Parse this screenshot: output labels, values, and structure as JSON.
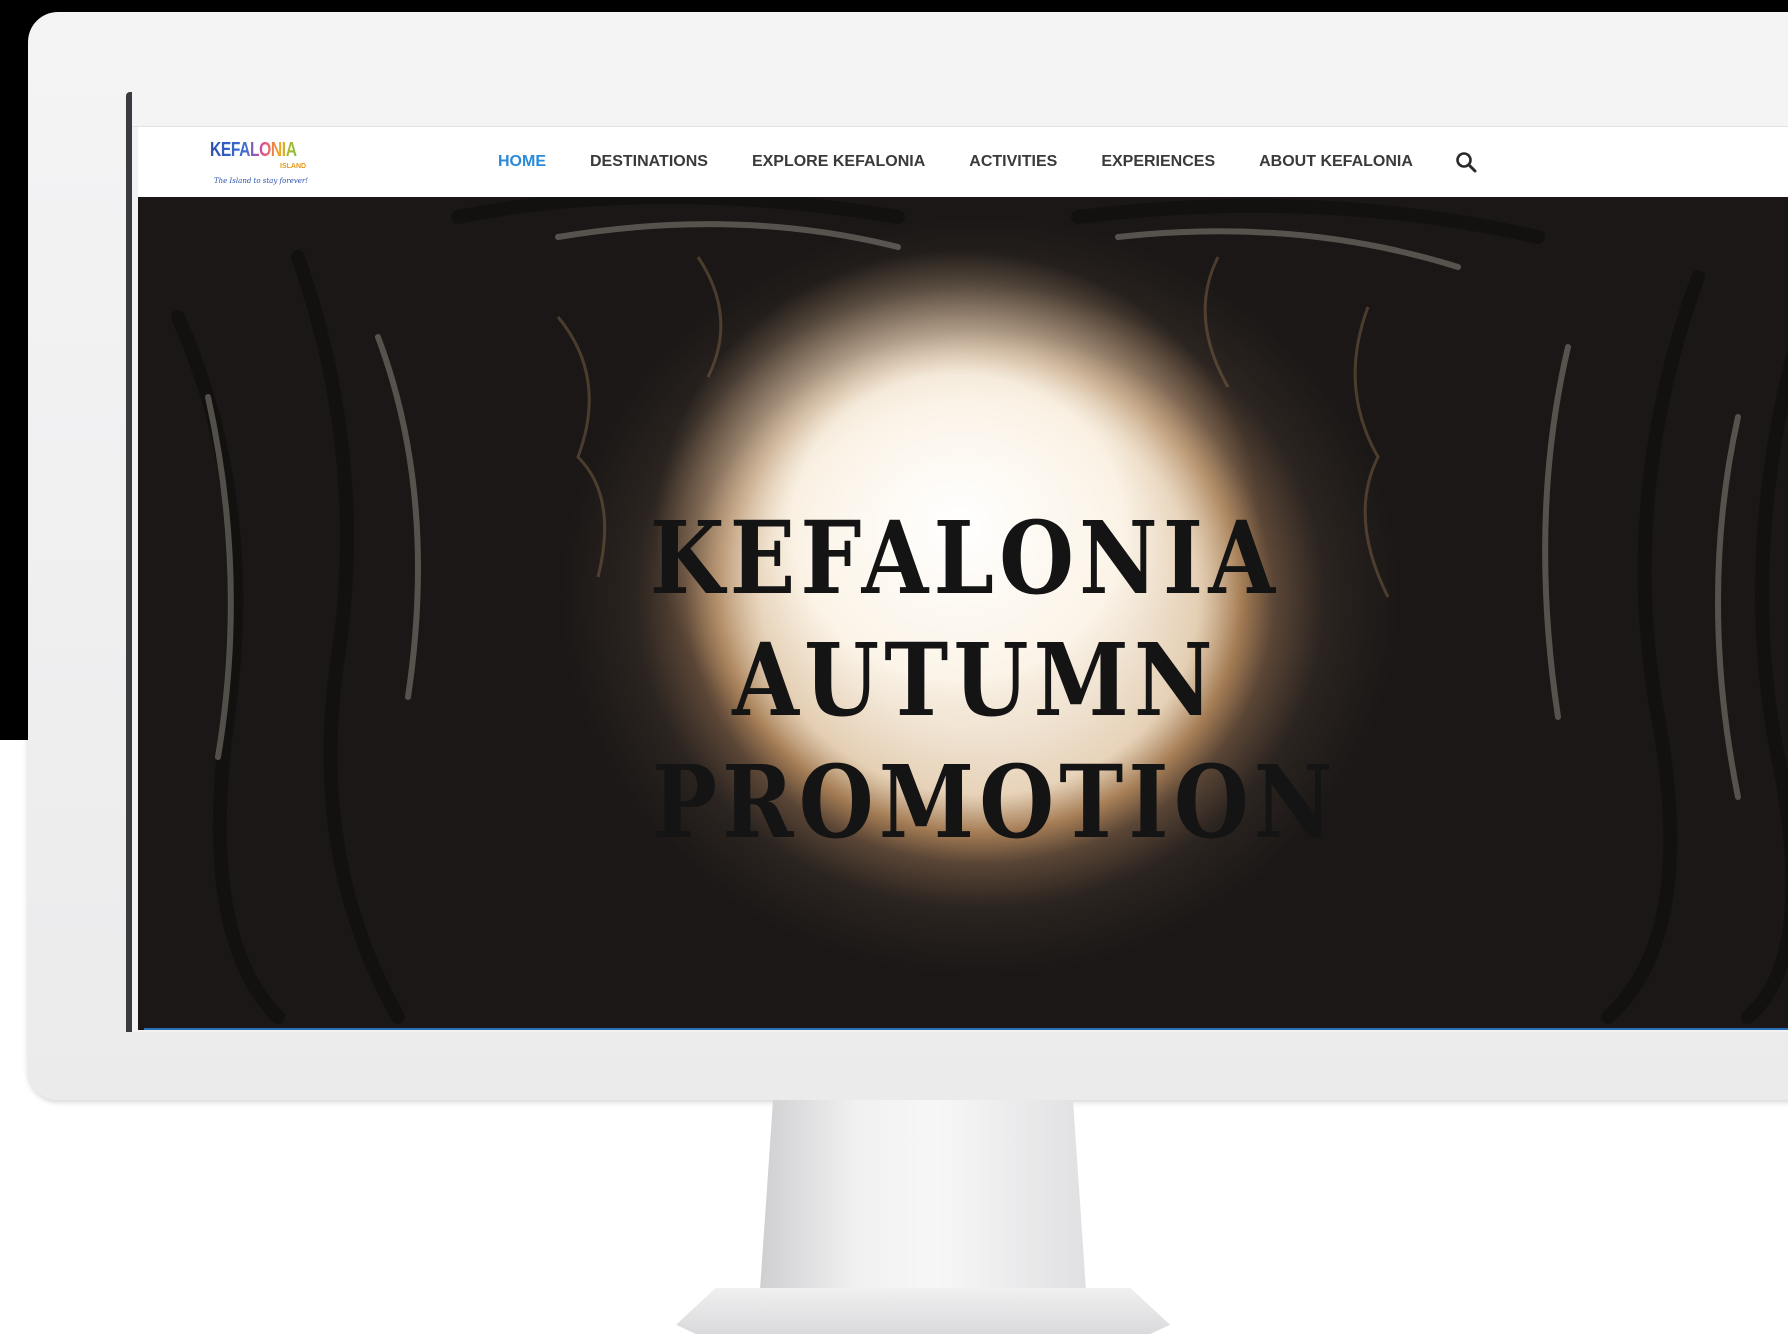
{
  "site": {
    "logo_text": "KEFALONIA",
    "logo_sub": "ISLAND",
    "logo_tagline": "The Island to stay forever!"
  },
  "nav": {
    "items": [
      {
        "label": "HOME",
        "active": true
      },
      {
        "label": "DESTINATIONS",
        "active": false
      },
      {
        "label": "EXPLORE KEFALONIA",
        "active": false
      },
      {
        "label": "ACTIVITIES",
        "active": false
      },
      {
        "label": "EXPERIENCES",
        "active": false
      },
      {
        "label": "ABOUT KEFALONIA",
        "active": false
      }
    ],
    "search_icon": "search-icon"
  },
  "hero": {
    "line1": "KEFALONIA",
    "line2": "AUTUMN",
    "line3": "PROMOTION"
  },
  "colors": {
    "nav_active": "#2a8ad8",
    "nav_text": "#3a3a3a",
    "hero_text": "#141414"
  }
}
